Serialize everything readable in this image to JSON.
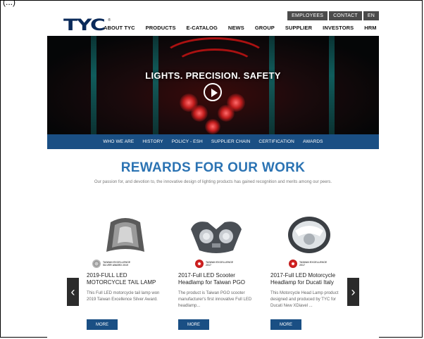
{
  "corner_label": "(...)",
  "utility_links": [
    "EMPLOYEES",
    "CONTACT",
    "EN"
  ],
  "logo": {
    "text": "TYC",
    "registered": "®"
  },
  "nav": [
    "ABOUT TYC",
    "PRODUCTS",
    "E-CATALOG",
    "NEWS",
    "GROUP",
    "SUPPLIER",
    "INVESTORS",
    "HRM"
  ],
  "hero": {
    "title": "LIGHTS. PRECISION. SAFETY"
  },
  "subnav": [
    "WHO WE ARE",
    "HISTORY",
    "POLICY - ESH",
    "SUPPLIER CHAIN",
    "CERTIFICATION",
    "AWARDS"
  ],
  "section": {
    "title": "REWARDS FOR OUR WORK",
    "subtitle": "Our passion for, and devotion to, the innovative design of lighting products has gained recognition and merits among our peers."
  },
  "cards": [
    {
      "award_line1": "TAIWAN EXCELLENCE",
      "award_line2": "SILVER AWARD 2019",
      "title": "2019-FULL LED MOTORCYCLE TAIL LAMP",
      "desc": "This Full LED motorcycle tail lamp won 2019 Taiwan Excellence Silver Award.",
      "button": "MORE"
    },
    {
      "award_line1": "TAIWAN EXCELLENCE",
      "award_line2": "2017",
      "title": "2017-Full LED Scooter Headlamp for Taiwan PGO",
      "desc": "The product is Taiwan PGO scooter manufacturer's first innovative Full LED headlamp...",
      "button": "MORE"
    },
    {
      "award_line1": "TAIWAN EXCELLENCE",
      "award_line2": "2017",
      "title": "2017-Full LED Motorcycle Headlamp for Ducati Italy",
      "desc": "This Motorcycle Head Lamp product designed and produced by TYC for Ducati New XDiavel ...",
      "button": "MORE"
    }
  ],
  "arrows": {
    "prev": "‹",
    "next": "›"
  },
  "icons": [
    "play-icon",
    "chevron-left-icon",
    "chevron-right-icon",
    "award-seal-icon"
  ],
  "colors": {
    "brand_blue": "#1a4f84",
    "title_blue": "#2b73b3",
    "dark": "#4b4b4b"
  }
}
